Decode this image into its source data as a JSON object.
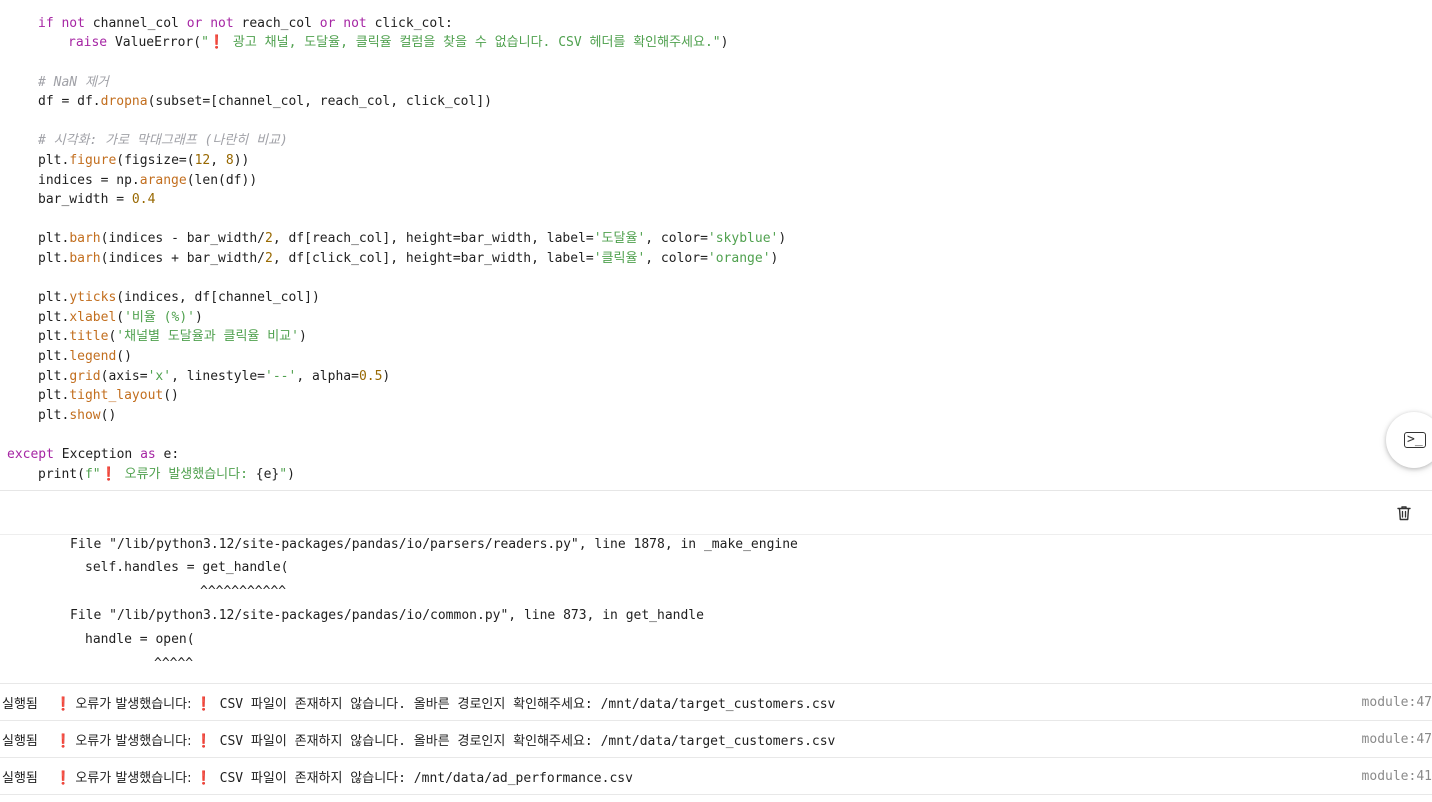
{
  "code": {
    "line1": {
      "kw_if": "if",
      "kw_not1": "not",
      "t1": " channel_col ",
      "kw_or1": "or",
      "kw_not2": "not",
      "t2": " reach_col ",
      "kw_or2": "or",
      "kw_not3": "not",
      "t3": " click_col:"
    },
    "line2": {
      "kw_raise": "raise",
      "t1": " ValueError(",
      "str": "\"❗ 광고 채널, 도달율, 클릭율 컬럼을 찾을 수 없습니다. CSV 헤더를 확인해주세요.\"",
      "t2": ")"
    },
    "line3": {
      "comment": "# NaN 제거"
    },
    "line4": {
      "t1": "df = df.",
      "fn": "dropna",
      "t2": "(subset=[channel_col, reach_col, click_col])"
    },
    "line5": {
      "comment": "# 시각화: 가로 막대그래프 (나란히 비교)"
    },
    "line6": {
      "t1": "plt.",
      "fn": "figure",
      "t2": "(figsize=(",
      "n1": "12",
      "t3": ", ",
      "n2": "8",
      "t4": "))"
    },
    "line7": {
      "t1": "indices = np.",
      "fn": "arange",
      "t2": "(len(df))"
    },
    "line8": {
      "t1": "bar_width = ",
      "n1": "0.4"
    },
    "line9": {
      "t1": "plt.",
      "fn": "barh",
      "t2": "(indices - bar_width/",
      "n1": "2",
      "t3": ", df[reach_col], height=bar_width, label=",
      "s1": "'도달율'",
      "t4": ", color=",
      "s2": "'skyblue'",
      "t5": ")"
    },
    "line10": {
      "t1": "plt.",
      "fn": "barh",
      "t2": "(indices + bar_width/",
      "n1": "2",
      "t3": ", df[click_col], height=bar_width, label=",
      "s1": "'클릭율'",
      "t4": ", color=",
      "s2": "'orange'",
      "t5": ")"
    },
    "line11": {
      "t1": "plt.",
      "fn": "yticks",
      "t2": "(indices, df[channel_col])"
    },
    "line12": {
      "t1": "plt.",
      "fn": "xlabel",
      "t2": "(",
      "s1": "'비율 (%)'",
      "t3": ")"
    },
    "line13": {
      "t1": "plt.",
      "fn": "title",
      "t2": "(",
      "s1": "'채널별 도달율과 클릭율 비교'",
      "t3": ")"
    },
    "line14": {
      "t1": "plt.",
      "fn": "legend",
      "t2": "()"
    },
    "line15": {
      "t1": "plt.",
      "fn": "grid",
      "t2": "(axis=",
      "s1": "'x'",
      "t3": ", linestyle=",
      "s2": "'--'",
      "t4": ", alpha=",
      "n1": "0.5",
      "t5": ")"
    },
    "line16": {
      "t1": "plt.",
      "fn": "tight_layout",
      "t2": "()"
    },
    "line17": {
      "t1": "plt.",
      "fn": "show",
      "t2": "()"
    },
    "line18": {
      "kw_except": "except",
      "t1": " Exception ",
      "kw_as": "as",
      "t2": " e:"
    },
    "line19": {
      "t1": "print(",
      "s1": "f\"❗ 오류가 발생했습니다: ",
      "t2": "{e}",
      "s2": "\"",
      "t3": ")"
    }
  },
  "fab": {
    "label": ">_"
  },
  "output": {
    "trace": [
      "File \"/lib/python3.12/site-packages/pandas/io/parsers/readers.py\", line 1878, in _make_engine",
      "self.handles = get_handle(",
      "^^^^^^^^^^^",
      "File \"/lib/python3.12/site-packages/pandas/io/common.py\", line 873, in get_handle",
      "handle = open(",
      "^^^^^"
    ],
    "logs": [
      {
        "status": "실행됨",
        "msg_a": "❗ 오류가 발생했습니다: ",
        "msg_b": "❗ CSV 파일이 존재하지 않습니다. 올바른 경로인지 확인해주세요: /mnt/data/target_customers.csv",
        "source": "module:47"
      },
      {
        "status": "실행됨",
        "msg_a": "❗ 오류가 발생했습니다: ",
        "msg_b": "❗ CSV 파일이 존재하지 않습니다. 올바른 경로인지 확인해주세요: /mnt/data/target_customers.csv",
        "source": "module:47"
      },
      {
        "status": "실행됨",
        "msg_a": "❗ 오류가 발생했습니다: ",
        "msg_b": "❗ CSV 파일이 존재하지 않습니다: /mnt/data/ad_performance.csv",
        "source": "module:41"
      }
    ]
  }
}
